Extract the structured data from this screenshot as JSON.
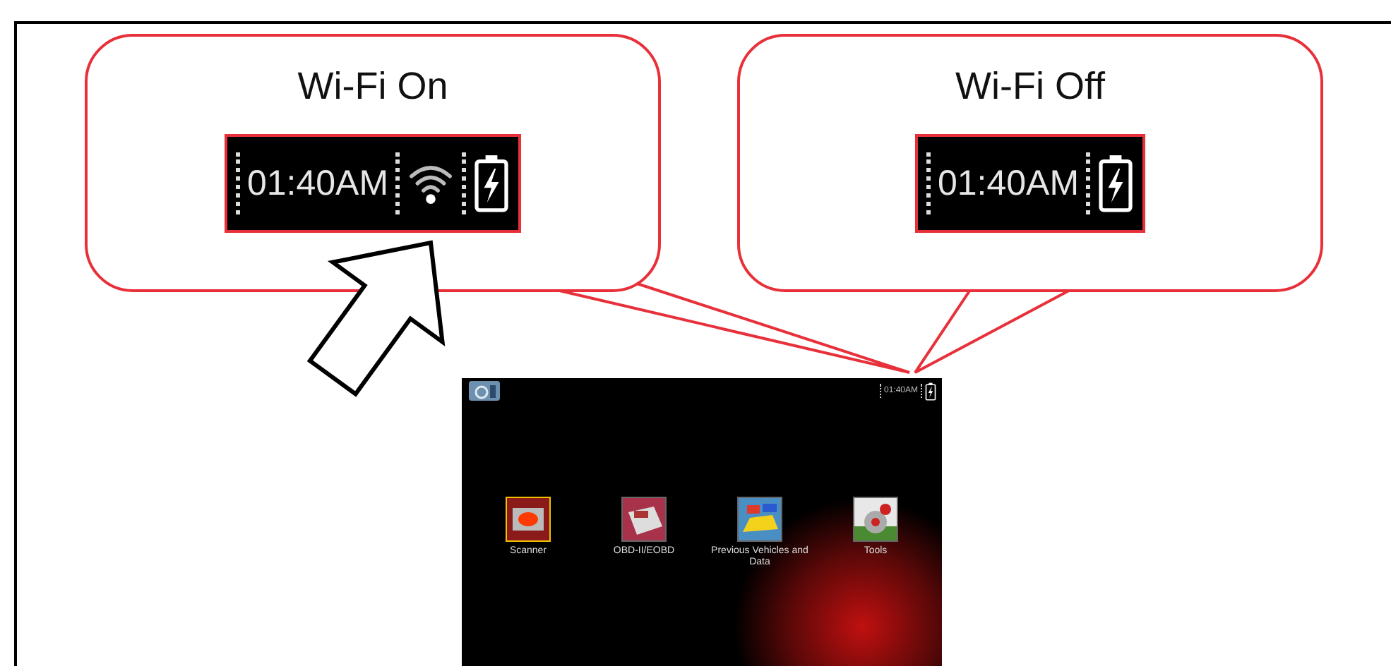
{
  "callouts": [
    {
      "title": "Wi-Fi On",
      "time": "01:40AM",
      "wifi": true
    },
    {
      "title": "Wi-Fi Off",
      "time": "01:40AM",
      "wifi": false
    }
  ],
  "device_screen": {
    "status_time": "01:40AM",
    "wifi": false,
    "menu_items": [
      {
        "label": "Scanner",
        "selected": true,
        "kind": "scanner"
      },
      {
        "label": "OBD-II/EOBD",
        "selected": false,
        "kind": "obd"
      },
      {
        "label": "Previous Vehicles and Data",
        "selected": false,
        "kind": "vehicles"
      },
      {
        "label": "Tools",
        "selected": false,
        "kind": "tools"
      }
    ]
  }
}
